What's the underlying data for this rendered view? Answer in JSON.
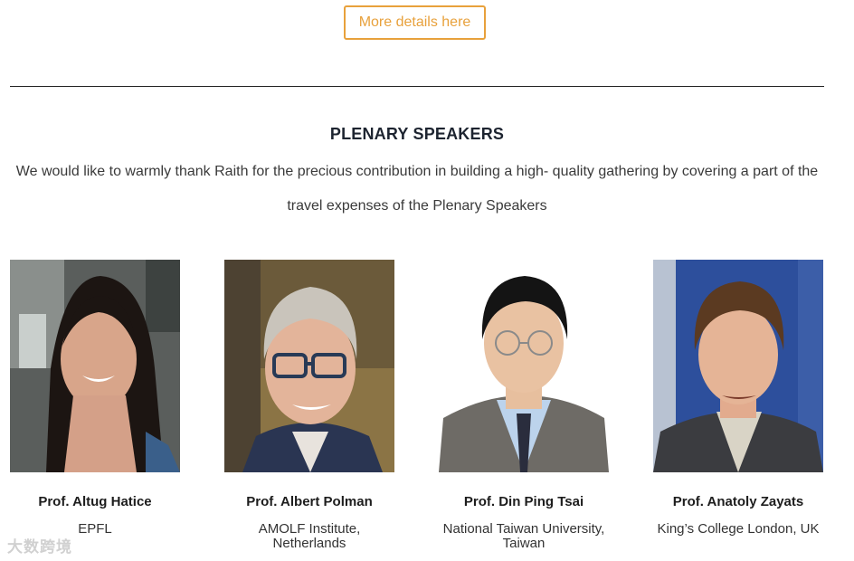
{
  "details_button": {
    "label": "More details here"
  },
  "section": {
    "title": "PLENARY SPEAKERS",
    "description": "We would like to warmly thank Raith for the precious contribution in building a high- quality gathering by covering a part of the travel expenses of the Plenary Speakers"
  },
  "speakers": [
    {
      "name": "Prof. Altug Hatice",
      "affiliation": "EPFL"
    },
    {
      "name": "Prof. Albert Polman",
      "affiliation": "AMOLF Institute, Netherlands"
    },
    {
      "name": "Prof. Din Ping Tsai",
      "affiliation": "National Taiwan University, Taiwan"
    },
    {
      "name": "Prof. Anatoly Zayats",
      "affiliation": "King’s College London, UK"
    }
  ],
  "watermark": {
    "text": "大数跨境"
  },
  "colors": {
    "accent": "#e8a13c",
    "title": "#1d2430",
    "text": "#333333"
  }
}
